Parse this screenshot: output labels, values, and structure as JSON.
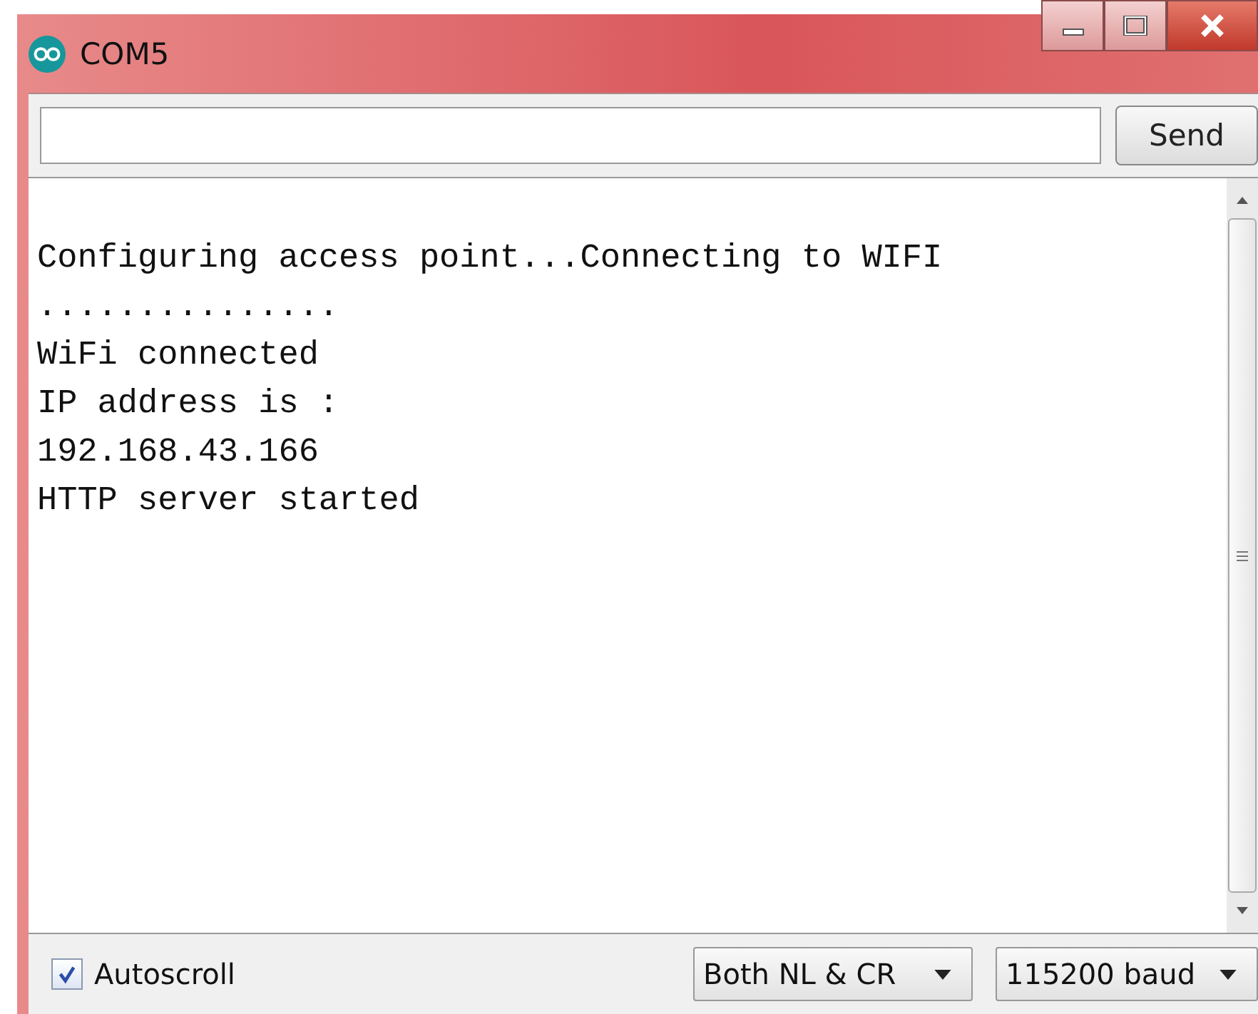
{
  "window": {
    "title": "COM5"
  },
  "send_button": "Send",
  "output_lines": [
    "Configuring access point...Connecting to WIFI",
    "...............",
    "WiFi connected",
    "IP address is :",
    "192.168.43.166",
    "HTTP server started"
  ],
  "autoscroll": {
    "label": "Autoscroll",
    "checked": true
  },
  "line_ending": {
    "value": "Both NL & CR"
  },
  "baud_rate": {
    "value": "115200 baud"
  }
}
